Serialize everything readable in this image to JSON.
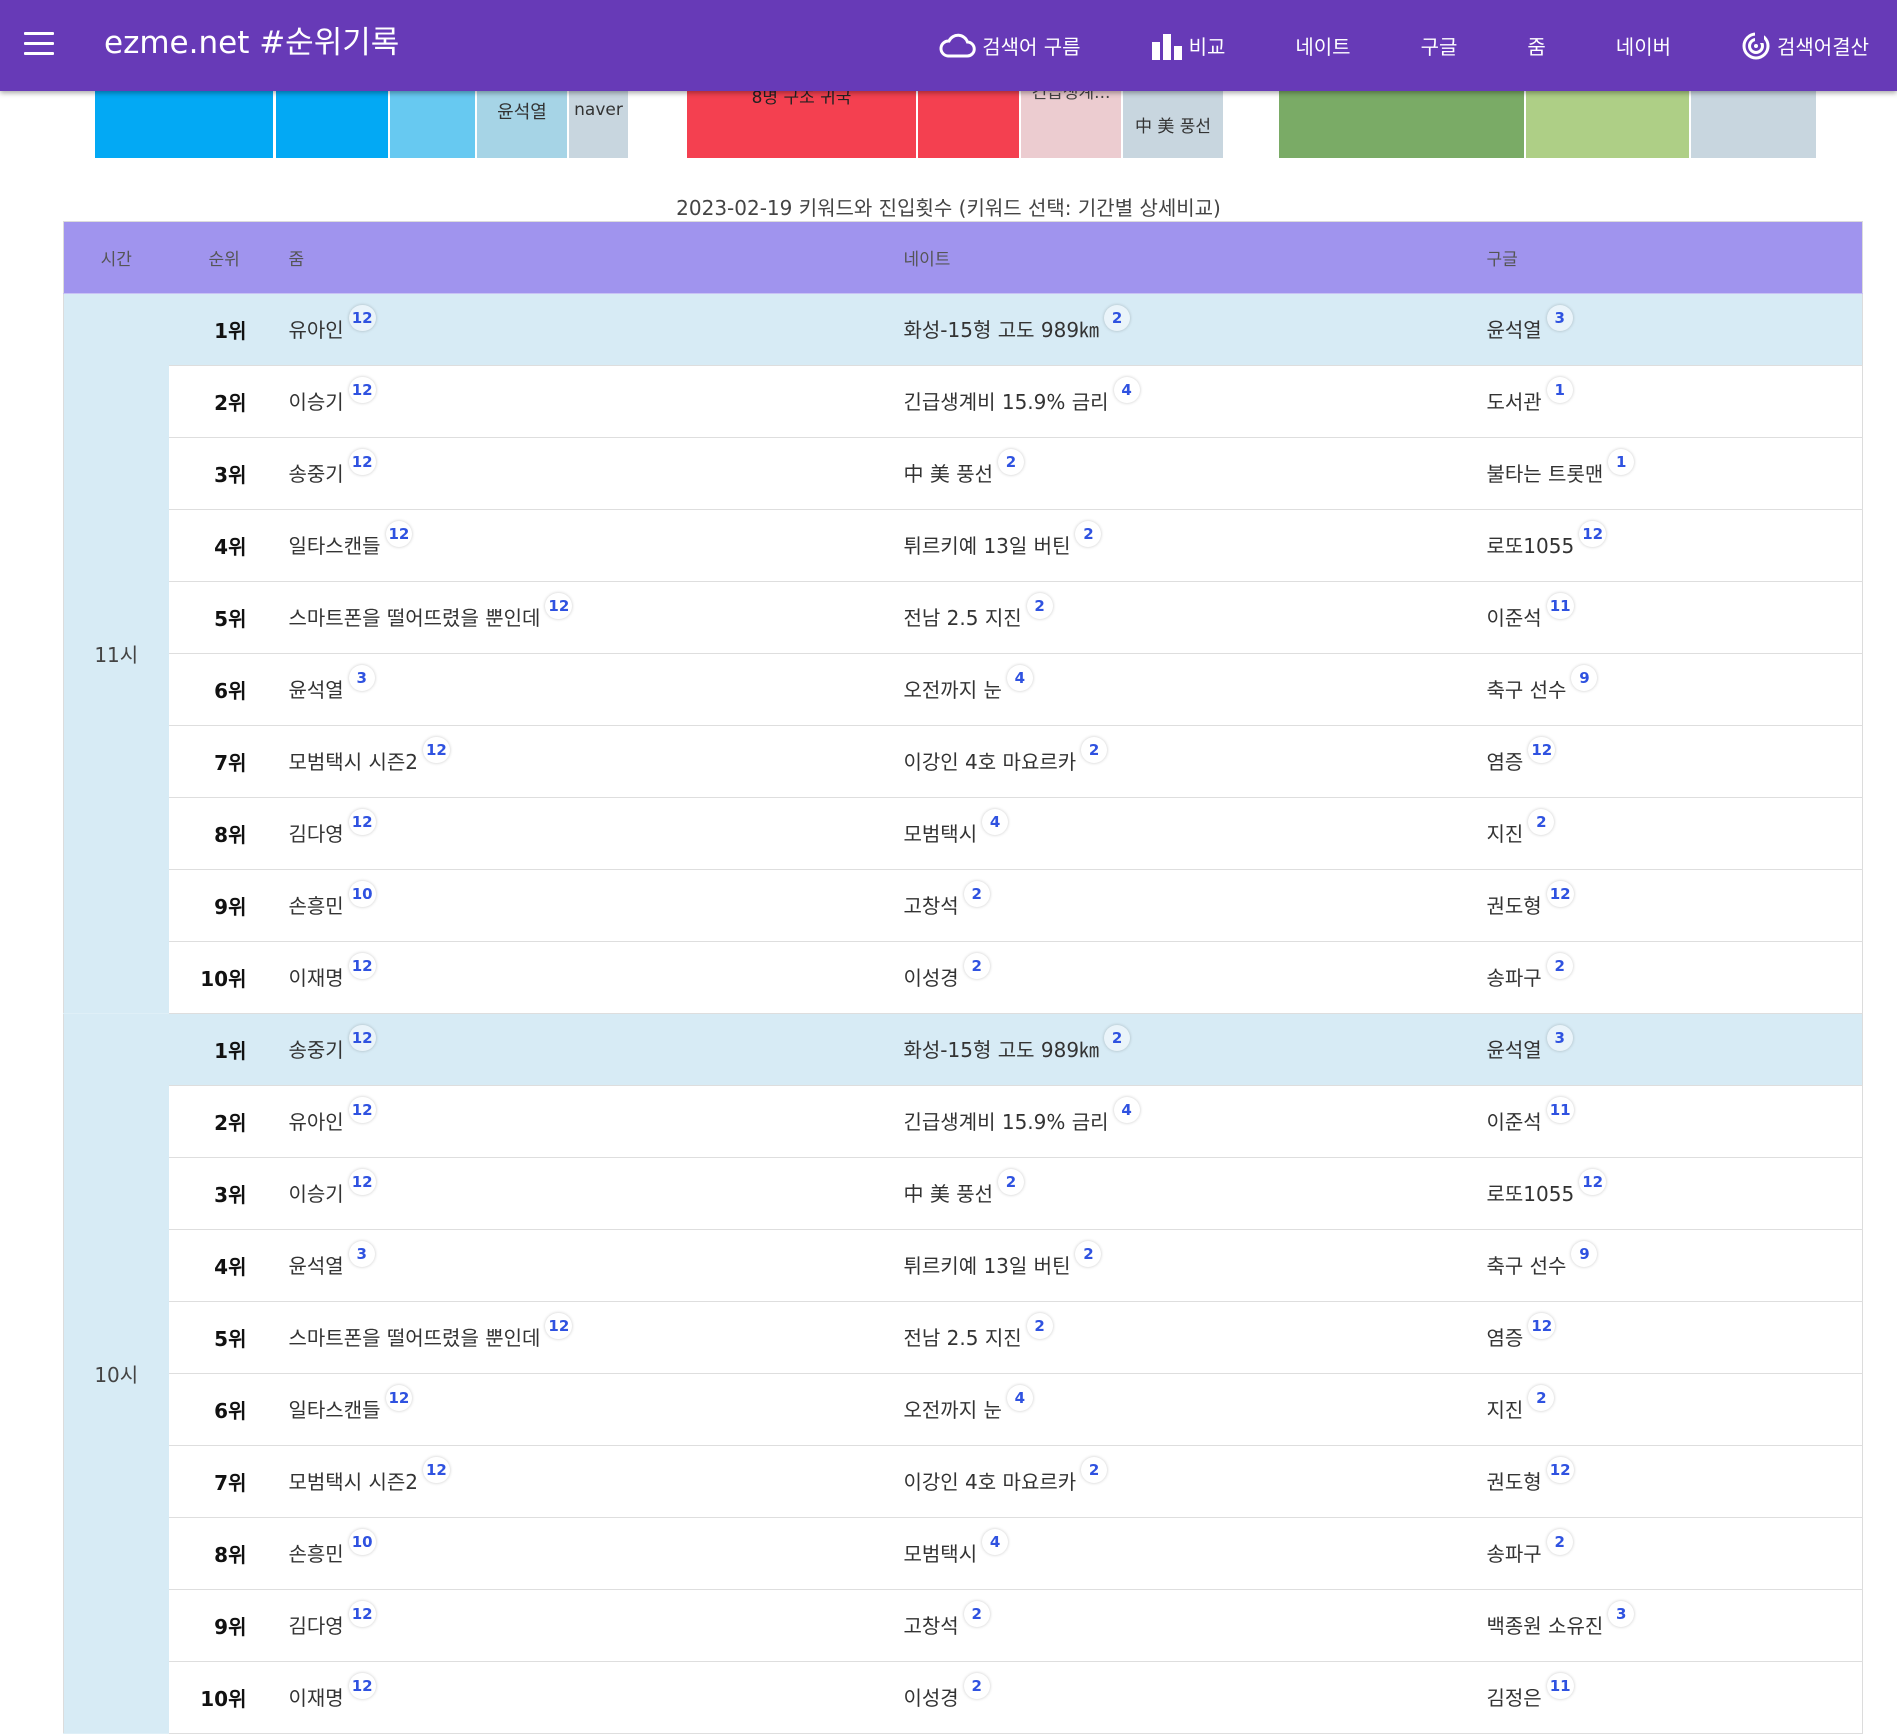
{
  "appbar": {
    "title": "ezme.net #순위기록",
    "nav": [
      {
        "label": "검색어 구름",
        "icon": "cloud-icon"
      },
      {
        "label": "비교",
        "icon": "bar-chart-icon"
      },
      {
        "label": "네이트",
        "icon": ""
      },
      {
        "label": "구글",
        "icon": ""
      },
      {
        "label": "줌",
        "icon": ""
      },
      {
        "label": "네이버",
        "icon": ""
      },
      {
        "label": "검색어결산",
        "icon": "target-icon"
      }
    ]
  },
  "treemap": {
    "groups": [
      {
        "cells": [
          {
            "label": "",
            "color": "#03a9f4"
          },
          {
            "label": "",
            "color": "#03a9f4"
          },
          {
            "label": "",
            "color": "#67c9f1"
          },
          {
            "label": "윤석열",
            "color": "#a6d4e6"
          },
          {
            "label": "naver",
            "color": "#c8d6df"
          }
        ]
      },
      {
        "cells": [
          {
            "label": "8명 구조 귀국",
            "color": "#f44050"
          },
          {
            "label": "",
            "color": "#f44050"
          },
          {
            "label": "긴급생계...",
            "color": "#ecccd0"
          },
          {
            "label": "中 美 풍선",
            "color": "#c8d6df"
          }
        ]
      },
      {
        "cells": [
          {
            "label": "",
            "color": "#7aab66"
          },
          {
            "label": "",
            "color": "#aecf86"
          },
          {
            "label": "",
            "color": "#c8d6df"
          }
        ]
      }
    ]
  },
  "caption": "2023-02-19 키워드와 진입횟수 (키워드 선택: 기간별 상세비교)",
  "table": {
    "headers": {
      "time": "시간",
      "rank": "순위",
      "zum": "줌",
      "nate": "네이트",
      "google": "구글"
    },
    "groups": [
      {
        "time": "11시",
        "rows": [
          {
            "rank": "1위",
            "zum": {
              "kw": "유아인",
              "n": "12"
            },
            "nate": {
              "kw": "화성-15형 고도 989㎞",
              "n": "2"
            },
            "google": {
              "kw": "윤석열",
              "n": "3"
            }
          },
          {
            "rank": "2위",
            "zum": {
              "kw": "이승기",
              "n": "12"
            },
            "nate": {
              "kw": "긴급생계비 15.9% 금리",
              "n": "4"
            },
            "google": {
              "kw": "도서관",
              "n": "1"
            }
          },
          {
            "rank": "3위",
            "zum": {
              "kw": "송중기",
              "n": "12"
            },
            "nate": {
              "kw": "中 美 풍선",
              "n": "2"
            },
            "google": {
              "kw": "불타는 트롯맨",
              "n": "1"
            }
          },
          {
            "rank": "4위",
            "zum": {
              "kw": "일타스캔들",
              "n": "12"
            },
            "nate": {
              "kw": "튀르키예 13일 버틴",
              "n": "2"
            },
            "google": {
              "kw": "로또1055",
              "n": "12"
            }
          },
          {
            "rank": "5위",
            "zum": {
              "kw": "스마트폰을 떨어뜨렸을 뿐인데",
              "n": "12"
            },
            "nate": {
              "kw": "전남 2.5 지진",
              "n": "2"
            },
            "google": {
              "kw": "이준석",
              "n": "11"
            }
          },
          {
            "rank": "6위",
            "zum": {
              "kw": "윤석열",
              "n": "3"
            },
            "nate": {
              "kw": "오전까지 눈",
              "n": "4"
            },
            "google": {
              "kw": "축구 선수",
              "n": "9"
            }
          },
          {
            "rank": "7위",
            "zum": {
              "kw": "모범택시 시즌2",
              "n": "12"
            },
            "nate": {
              "kw": "이강인 4호 마요르카",
              "n": "2"
            },
            "google": {
              "kw": "염증",
              "n": "12"
            }
          },
          {
            "rank": "8위",
            "zum": {
              "kw": "김다영",
              "n": "12"
            },
            "nate": {
              "kw": "모범택시",
              "n": "4"
            },
            "google": {
              "kw": "지진",
              "n": "2"
            }
          },
          {
            "rank": "9위",
            "zum": {
              "kw": "손흥민",
              "n": "10"
            },
            "nate": {
              "kw": "고창석",
              "n": "2"
            },
            "google": {
              "kw": "권도형",
              "n": "12"
            }
          },
          {
            "rank": "10위",
            "zum": {
              "kw": "이재명",
              "n": "12"
            },
            "nate": {
              "kw": "이성경",
              "n": "2"
            },
            "google": {
              "kw": "송파구",
              "n": "2"
            }
          }
        ]
      },
      {
        "time": "10시",
        "rows": [
          {
            "rank": "1위",
            "zum": {
              "kw": "송중기",
              "n": "12"
            },
            "nate": {
              "kw": "화성-15형 고도 989㎞",
              "n": "2"
            },
            "google": {
              "kw": "윤석열",
              "n": "3"
            }
          },
          {
            "rank": "2위",
            "zum": {
              "kw": "유아인",
              "n": "12"
            },
            "nate": {
              "kw": "긴급생계비 15.9% 금리",
              "n": "4"
            },
            "google": {
              "kw": "이준석",
              "n": "11"
            }
          },
          {
            "rank": "3위",
            "zum": {
              "kw": "이승기",
              "n": "12"
            },
            "nate": {
              "kw": "中 美 풍선",
              "n": "2"
            },
            "google": {
              "kw": "로또1055",
              "n": "12"
            }
          },
          {
            "rank": "4위",
            "zum": {
              "kw": "윤석열",
              "n": "3"
            },
            "nate": {
              "kw": "튀르키예 13일 버틴",
              "n": "2"
            },
            "google": {
              "kw": "축구 선수",
              "n": "9"
            }
          },
          {
            "rank": "5위",
            "zum": {
              "kw": "스마트폰을 떨어뜨렸을 뿐인데",
              "n": "12"
            },
            "nate": {
              "kw": "전남 2.5 지진",
              "n": "2"
            },
            "google": {
              "kw": "염증",
              "n": "12"
            }
          },
          {
            "rank": "6위",
            "zum": {
              "kw": "일타스캔들",
              "n": "12"
            },
            "nate": {
              "kw": "오전까지 눈",
              "n": "4"
            },
            "google": {
              "kw": "지진",
              "n": "2"
            }
          },
          {
            "rank": "7위",
            "zum": {
              "kw": "모범택시 시즌2",
              "n": "12"
            },
            "nate": {
              "kw": "이강인 4호 마요르카",
              "n": "2"
            },
            "google": {
              "kw": "권도형",
              "n": "12"
            }
          },
          {
            "rank": "8위",
            "zum": {
              "kw": "손흥민",
              "n": "10"
            },
            "nate": {
              "kw": "모범택시",
              "n": "4"
            },
            "google": {
              "kw": "송파구",
              "n": "2"
            }
          },
          {
            "rank": "9위",
            "zum": {
              "kw": "김다영",
              "n": "12"
            },
            "nate": {
              "kw": "고창석",
              "n": "2"
            },
            "google": {
              "kw": "백종원 소유진",
              "n": "3"
            }
          },
          {
            "rank": "10위",
            "zum": {
              "kw": "이재명",
              "n": "12"
            },
            "nate": {
              "kw": "이성경",
              "n": "2"
            },
            "google": {
              "kw": "김정은",
              "n": "11"
            }
          }
        ]
      }
    ]
  }
}
